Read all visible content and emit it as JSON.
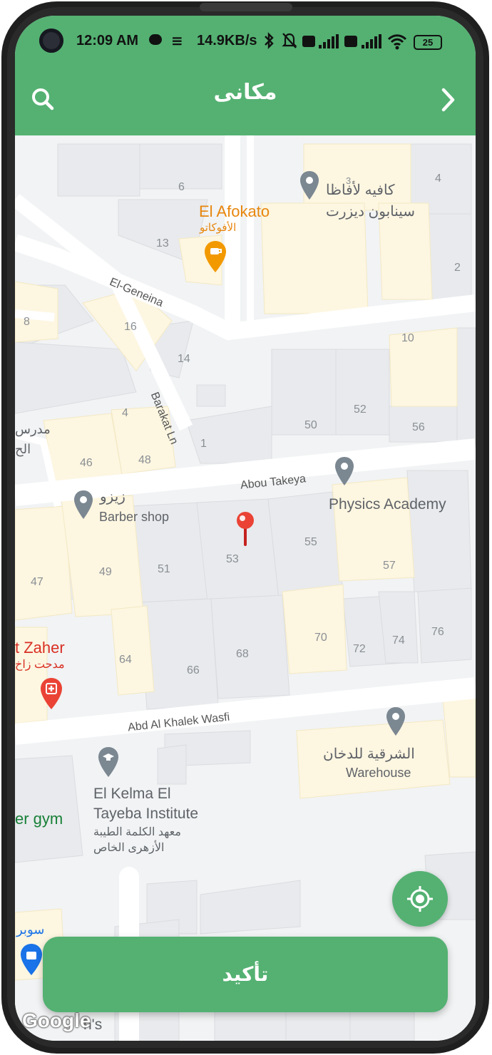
{
  "status_bar": {
    "time": "12:09 AM",
    "net_speed": "14.9KB/s",
    "battery": "25"
  },
  "app_bar": {
    "title": "مكانى",
    "search_icon": "search-icon",
    "forward_icon": "chevron-right-icon"
  },
  "map": {
    "streets": [
      "El-Geneina",
      "Barakat Ln",
      "Abou Takeya",
      "Abd Al Khalek Wasfi"
    ],
    "building_numbers": [
      "6",
      "4",
      "13",
      "2",
      "8",
      "16",
      "14",
      "10",
      "4",
      "50",
      "52",
      "56",
      "1",
      "46",
      "48",
      "47",
      "49",
      "51",
      "53",
      "55",
      "57",
      "70",
      "72",
      "74",
      "76",
      "64",
      "66",
      "68",
      "3"
    ],
    "pois": {
      "afokato_en": "El Afokato",
      "afokato_ar": "الأفوكاتو",
      "cafe_ar_line1": "كافيه لأفاظا",
      "cafe_ar_line2": "سينابون ديزرت",
      "school_ar_line1": "مدرس",
      "school_ar_line2": "الح",
      "barber_ar": "زيزو",
      "barber_en": "Barber shop",
      "physics": "Physics Academy",
      "zaher_en": "t Zaher",
      "zaher_ar": "مدحت زاخ",
      "warehouse_ar": "الشرقية للدخان",
      "warehouse_en": "Warehouse",
      "kelma_line1": "El Kelma El",
      "kelma_line2": "Tayeba Institute",
      "kelma_ar_line1": "معهد الكلمة الطيبة",
      "kelma_ar_line2": "الأزهرى الخاص",
      "gym": "er gym",
      "market_ar": "سوبر",
      "partial_bottom": "h's"
    },
    "attribution": "Google"
  },
  "locate_button": {
    "icon": "my-location-icon"
  },
  "confirm_button": {
    "label": "تأكيد"
  },
  "colors": {
    "primary": "#54b172",
    "map_bg": "#f1f3f4",
    "building": "#e8eaed",
    "commercial": "#fdf6e1",
    "pin_red": "#ea4335"
  }
}
